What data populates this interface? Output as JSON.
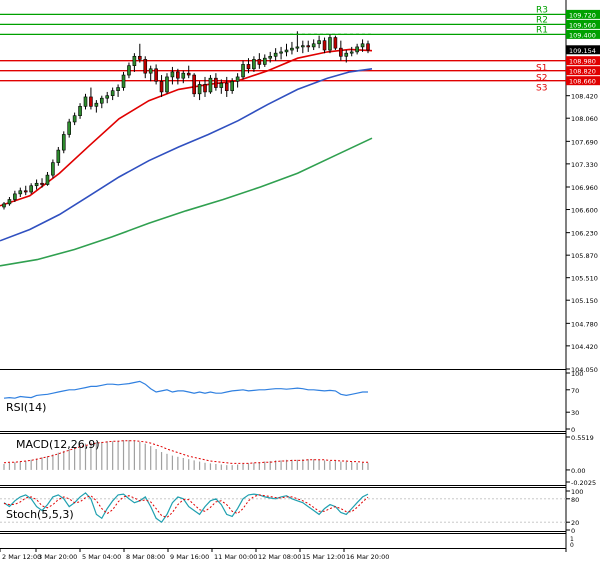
{
  "chart_data": {
    "type": "candlestick",
    "price_panel": {
      "y_ticks": [
        "109.720",
        "109.560",
        "109.400",
        "109.154",
        "108.980",
        "108.820",
        "108.660",
        "108.420",
        "108.060",
        "107.690",
        "107.330",
        "106.960",
        "106.600",
        "106.230",
        "105.870",
        "105.510",
        "105.150",
        "104.780",
        "104.420",
        "104.050"
      ],
      "y_range": [
        104.05,
        109.95
      ],
      "current_price": "109.154",
      "levels": [
        {
          "name": "R3",
          "label": "109.720",
          "value": 109.72,
          "color": "#00a000",
          "style": "solid"
        },
        {
          "name": "R2",
          "label": "109.560",
          "value": 109.56,
          "color": "#00a000",
          "style": "solid"
        },
        {
          "name": "R1",
          "label": "109.400",
          "value": 109.4,
          "color": "#00a000",
          "style": "solid"
        },
        {
          "name": "S1",
          "label": "108.980",
          "value": 108.98,
          "color": "#e00000",
          "style": "solid"
        },
        {
          "name": "S2",
          "label": "108.820",
          "value": 108.82,
          "color": "#e00000",
          "style": "solid"
        },
        {
          "name": "S3",
          "label": "108.660",
          "value": 108.66,
          "color": "#e00000",
          "style": "solid"
        }
      ],
      "candles": [
        [
          106.64,
          106.72,
          106.6,
          106.69
        ],
        [
          106.69,
          106.8,
          106.66,
          106.76
        ],
        [
          106.76,
          106.9,
          106.72,
          106.85
        ],
        [
          106.85,
          106.95,
          106.8,
          106.9
        ],
        [
          106.9,
          106.98,
          106.83,
          106.88
        ],
        [
          106.88,
          107.02,
          106.85,
          106.98
        ],
        [
          106.98,
          107.08,
          106.92,
          107.02
        ],
        [
          107.02,
          107.1,
          106.95,
          107.0
        ],
        [
          107.0,
          107.2,
          106.98,
          107.15
        ],
        [
          107.15,
          107.4,
          107.1,
          107.35
        ],
        [
          107.35,
          107.6,
          107.3,
          107.55
        ],
        [
          107.55,
          107.85,
          107.5,
          107.8
        ],
        [
          107.8,
          108.05,
          107.75,
          108.0
        ],
        [
          108.0,
          108.15,
          107.95,
          108.1
        ],
        [
          108.1,
          108.3,
          108.05,
          108.25
        ],
        [
          108.25,
          108.45,
          108.2,
          108.4
        ],
        [
          108.4,
          108.55,
          108.2,
          108.25
        ],
        [
          108.25,
          108.35,
          108.15,
          108.3
        ],
        [
          108.3,
          108.42,
          108.22,
          108.38
        ],
        [
          108.38,
          108.48,
          108.3,
          108.42
        ],
        [
          108.42,
          108.55,
          108.35,
          108.5
        ],
        [
          108.5,
          108.6,
          108.4,
          108.55
        ],
        [
          108.55,
          108.8,
          108.5,
          108.75
        ],
        [
          108.75,
          108.95,
          108.7,
          108.9
        ],
        [
          108.9,
          109.1,
          108.8,
          109.05
        ],
        [
          109.05,
          109.25,
          108.95,
          109.0
        ],
        [
          109.0,
          109.05,
          108.7,
          108.78
        ],
        [
          108.78,
          108.9,
          108.65,
          108.85
        ],
        [
          108.85,
          108.92,
          108.6,
          108.65
        ],
        [
          108.65,
          108.75,
          108.4,
          108.48
        ],
        [
          108.48,
          108.78,
          108.45,
          108.72
        ],
        [
          108.72,
          108.88,
          108.6,
          108.8
        ],
        [
          108.8,
          108.85,
          108.6,
          108.7
        ],
        [
          108.7,
          108.82,
          108.62,
          108.78
        ],
        [
          108.78,
          108.9,
          108.7,
          108.75
        ],
        [
          108.75,
          108.78,
          108.4,
          108.45
        ],
        [
          108.45,
          108.65,
          108.35,
          108.6
        ],
        [
          108.6,
          108.72,
          108.4,
          108.48
        ],
        [
          108.48,
          108.75,
          108.45,
          108.7
        ],
        [
          108.7,
          108.78,
          108.5,
          108.55
        ],
        [
          108.55,
          108.68,
          108.45,
          108.62
        ],
        [
          108.62,
          108.72,
          108.4,
          108.5
        ],
        [
          108.5,
          108.7,
          108.45,
          108.65
        ],
        [
          108.65,
          108.78,
          108.55,
          108.72
        ],
        [
          108.72,
          108.98,
          108.68,
          108.92
        ],
        [
          108.92,
          109.02,
          108.78,
          108.85
        ],
        [
          108.85,
          109.05,
          108.8,
          109.0
        ],
        [
          109.0,
          109.1,
          108.85,
          108.92
        ],
        [
          108.92,
          109.08,
          108.88,
          109.02
        ],
        [
          109.02,
          109.12,
          108.95,
          109.05
        ],
        [
          109.05,
          109.18,
          108.98,
          109.1
        ],
        [
          109.1,
          109.2,
          109.0,
          109.12
        ],
        [
          109.12,
          109.25,
          109.05,
          109.15
        ],
        [
          109.15,
          109.28,
          109.08,
          109.18
        ],
        [
          109.18,
          109.45,
          109.12,
          109.2
        ],
        [
          109.2,
          109.3,
          109.1,
          109.22
        ],
        [
          109.22,
          109.3,
          109.12,
          109.2
        ],
        [
          109.2,
          109.32,
          109.15,
          109.25
        ],
        [
          109.25,
          109.38,
          109.18,
          109.3
        ],
        [
          109.3,
          109.35,
          109.1,
          109.15
        ],
        [
          109.15,
          109.4,
          109.1,
          109.35
        ],
        [
          109.35,
          109.38,
          109.15,
          109.18
        ],
        [
          109.18,
          109.3,
          108.98,
          109.05
        ],
        [
          109.05,
          109.15,
          108.95,
          109.1
        ],
        [
          109.1,
          109.2,
          109.05,
          109.12
        ],
        [
          109.12,
          109.25,
          109.08,
          109.2
        ],
        [
          109.2,
          109.32,
          109.12,
          109.25
        ],
        [
          109.25,
          109.3,
          109.1,
          109.15
        ]
      ],
      "moving_averages": [
        {
          "color": "#e00000",
          "points": [
            [
              0,
              106.66
            ],
            [
              0.08,
              106.82
            ],
            [
              0.16,
              107.18
            ],
            [
              0.24,
              107.62
            ],
            [
              0.32,
              108.05
            ],
            [
              0.4,
              108.34
            ],
            [
              0.48,
              108.52
            ],
            [
              0.56,
              108.6
            ],
            [
              0.64,
              108.66
            ],
            [
              0.72,
              108.82
            ],
            [
              0.8,
              109.02
            ],
            [
              0.88,
              109.12
            ],
            [
              0.94,
              109.16
            ],
            [
              1.0,
              109.14
            ]
          ]
        },
        {
          "color": "#3050c0",
          "points": [
            [
              0,
              106.1
            ],
            [
              0.08,
              106.28
            ],
            [
              0.16,
              106.52
            ],
            [
              0.24,
              106.82
            ],
            [
              0.32,
              107.12
            ],
            [
              0.4,
              107.38
            ],
            [
              0.48,
              107.6
            ],
            [
              0.56,
              107.8
            ],
            [
              0.64,
              108.02
            ],
            [
              0.72,
              108.28
            ],
            [
              0.8,
              108.52
            ],
            [
              0.88,
              108.7
            ],
            [
              0.94,
              108.8
            ],
            [
              1.0,
              108.85
            ]
          ]
        },
        {
          "color": "#30a050",
          "points": [
            [
              0,
              105.7
            ],
            [
              0.1,
              105.8
            ],
            [
              0.2,
              105.96
            ],
            [
              0.3,
              106.16
            ],
            [
              0.4,
              106.38
            ],
            [
              0.5,
              106.58
            ],
            [
              0.6,
              106.76
            ],
            [
              0.7,
              106.96
            ],
            [
              0.8,
              107.18
            ],
            [
              0.9,
              107.46
            ],
            [
              1.0,
              107.74
            ]
          ]
        }
      ]
    },
    "rsi_panel": {
      "label": "RSI(14)",
      "y_ticks": [
        "100",
        "70",
        "30",
        "0"
      ],
      "range": [
        0,
        100
      ],
      "color": "#3080e0",
      "values": [
        55,
        56,
        55,
        58,
        57,
        56,
        60,
        61,
        62,
        64,
        66,
        68,
        70,
        70,
        72,
        74,
        76,
        76,
        78,
        80,
        80,
        79,
        80,
        81,
        83,
        85,
        80,
        72,
        66,
        68,
        70,
        66,
        68,
        68,
        66,
        64,
        66,
        64,
        66,
        64,
        64,
        66,
        68,
        69,
        70,
        68,
        69,
        70,
        70,
        71,
        72,
        72,
        71,
        72,
        73,
        72,
        70,
        70,
        69,
        68,
        69,
        68,
        62,
        60,
        62,
        64,
        66,
        66
      ]
    },
    "macd_panel": {
      "label": "MACD(12,26,9)",
      "y_ticks": [
        "0.5519",
        "0.00",
        "-0.2025"
      ],
      "range": [
        -0.2025,
        0.5519
      ],
      "hist_color": "#a0a0a0",
      "signal_color": "#e00000",
      "histogram": [
        0.1,
        0.12,
        0.13,
        0.14,
        0.15,
        0.17,
        0.19,
        0.21,
        0.23,
        0.26,
        0.29,
        0.32,
        0.35,
        0.38,
        0.41,
        0.44,
        0.46,
        0.47,
        0.47,
        0.48,
        0.48,
        0.49,
        0.5,
        0.5,
        0.49,
        0.47,
        0.44,
        0.4,
        0.35,
        0.3,
        0.27,
        0.24,
        0.22,
        0.2,
        0.18,
        0.16,
        0.14,
        0.12,
        0.11,
        0.1,
        0.09,
        0.08,
        0.08,
        0.09,
        0.1,
        0.11,
        0.12,
        0.13,
        0.14,
        0.15,
        0.16,
        0.16,
        0.17,
        0.17,
        0.17,
        0.18,
        0.18,
        0.18,
        0.17,
        0.16,
        0.15,
        0.15,
        0.14,
        0.14,
        0.13,
        0.12,
        0.12,
        0.12
      ],
      "signal": [
        0.12,
        0.13,
        0.13,
        0.14,
        0.15,
        0.16,
        0.18,
        0.2,
        0.22,
        0.24,
        0.27,
        0.3,
        0.33,
        0.36,
        0.39,
        0.41,
        0.43,
        0.45,
        0.46,
        0.47,
        0.48,
        0.48,
        0.49,
        0.49,
        0.49,
        0.48,
        0.47,
        0.45,
        0.42,
        0.39,
        0.35,
        0.32,
        0.29,
        0.26,
        0.23,
        0.21,
        0.19,
        0.17,
        0.15,
        0.14,
        0.13,
        0.12,
        0.11,
        0.11,
        0.11,
        0.11,
        0.12,
        0.12,
        0.13,
        0.13,
        0.14,
        0.15,
        0.15,
        0.16,
        0.16,
        0.16,
        0.17,
        0.17,
        0.17,
        0.17,
        0.16,
        0.16,
        0.15,
        0.15,
        0.14,
        0.14,
        0.13,
        0.13
      ]
    },
    "stoch_panel": {
      "label": "Stoch(5,5,3)",
      "y_ticks": [
        "100",
        "80",
        "20",
        "0"
      ],
      "range": [
        0,
        100
      ],
      "main_color": "#20a0b0",
      "signal_color": "#e00000",
      "main": [
        70,
        60,
        75,
        85,
        90,
        80,
        60,
        50,
        65,
        85,
        90,
        80,
        60,
        70,
        85,
        95,
        80,
        40,
        30,
        55,
        75,
        90,
        92,
        80,
        70,
        75,
        85,
        60,
        30,
        20,
        40,
        70,
        85,
        80,
        60,
        50,
        40,
        60,
        75,
        80,
        65,
        40,
        35,
        55,
        80,
        90,
        92,
        90,
        85,
        82,
        80,
        85,
        88,
        80,
        75,
        70,
        60,
        50,
        40,
        55,
        65,
        60,
        45,
        40,
        55,
        70,
        85,
        92
      ],
      "signal": [
        68,
        65,
        66,
        72,
        82,
        85,
        78,
        62,
        57,
        65,
        78,
        85,
        80,
        70,
        72,
        83,
        88,
        75,
        55,
        42,
        52,
        72,
        85,
        88,
        82,
        75,
        77,
        72,
        55,
        37,
        32,
        45,
        65,
        78,
        78,
        65,
        52,
        48,
        58,
        72,
        75,
        65,
        48,
        42,
        55,
        75,
        86,
        90,
        88,
        86,
        83,
        82,
        85,
        85,
        80,
        75,
        68,
        58,
        48,
        48,
        55,
        60,
        55,
        47,
        47,
        58,
        72,
        84
      ]
    },
    "x_labels": [
      "2 Mar 12:00",
      "3 Mar 20:00",
      "5 Mar 04:00",
      "8 Mar 08:00",
      "9 Mar 16:00",
      "11 Mar 00:00",
      "12 Mar 08:00",
      "15 Mar 12:00",
      "16 Mar 20:00"
    ]
  }
}
